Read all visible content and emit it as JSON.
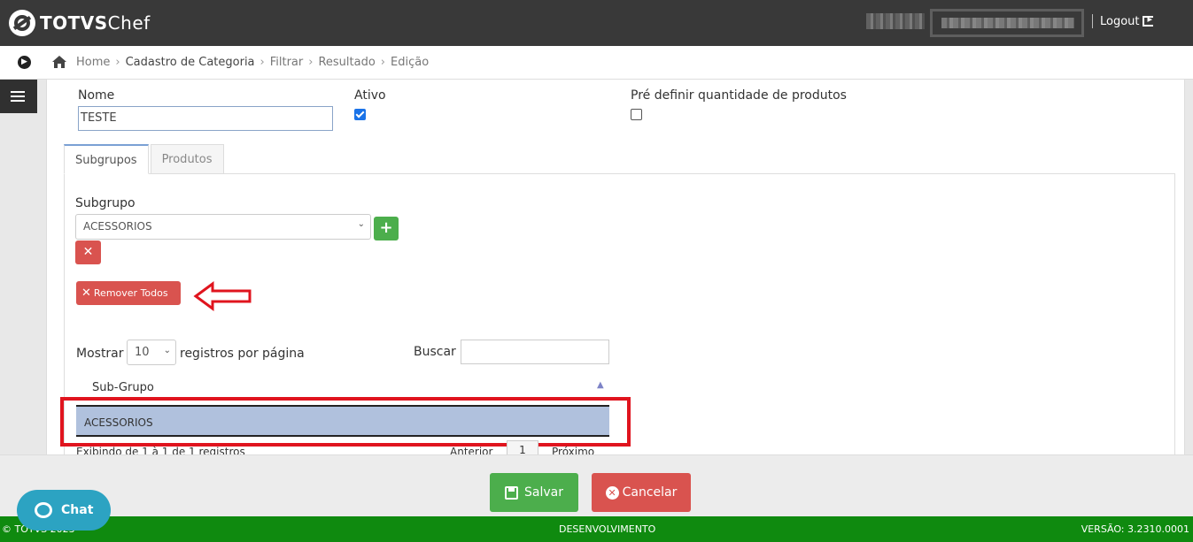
{
  "app": {
    "logo_main": "TOTVS",
    "logo_sub": "Chef"
  },
  "header": {
    "logout_label": "Logout"
  },
  "breadcrumb": {
    "home": "Home",
    "items": [
      "Cadastro de Categoria",
      "Filtrar",
      "Resultado",
      "Edição"
    ]
  },
  "form": {
    "nome_label": "Nome",
    "nome_value": "TESTE",
    "ativo_label": "Ativo",
    "ativo_checked": true,
    "predefinir_label": "Pré definir quantidade de produtos",
    "predefinir_checked": false
  },
  "tabs": [
    {
      "label": "Subgrupos",
      "active": true
    },
    {
      "label": "Produtos",
      "active": false
    }
  ],
  "subgrupo": {
    "label": "Subgrupo",
    "selected": "ACESSORIOS",
    "add_icon": "plus-icon",
    "remove_icon": "times-icon",
    "remove_all_label": "Remover Todos"
  },
  "table": {
    "length_prefix": "Mostrar",
    "length_value": "10",
    "length_suffix": "registros por página",
    "search_label": "Buscar",
    "column_header": "Sub-Grupo",
    "rows": [
      "ACESSORIOS"
    ],
    "info_text": "Exibindo de 1 à 1 de 1 registros",
    "pag_prev": "Anterior",
    "pag_page": "1",
    "pag_next": "Próximo"
  },
  "actions": {
    "save_label": "Salvar",
    "cancel_label": "Cancelar"
  },
  "chat": {
    "label": "Chat"
  },
  "footer": {
    "copyright": "© TOTVS 2023",
    "environment": "DESENVOLVIMENTO",
    "version": "VERSÃO: 3.2310.0001"
  },
  "colors": {
    "topbar": "#393939",
    "success": "#4cae4c",
    "danger": "#d9534f",
    "footer": "#0f8a0f",
    "selected_row": "#b0c1dd",
    "annotation": "#e0141e"
  }
}
